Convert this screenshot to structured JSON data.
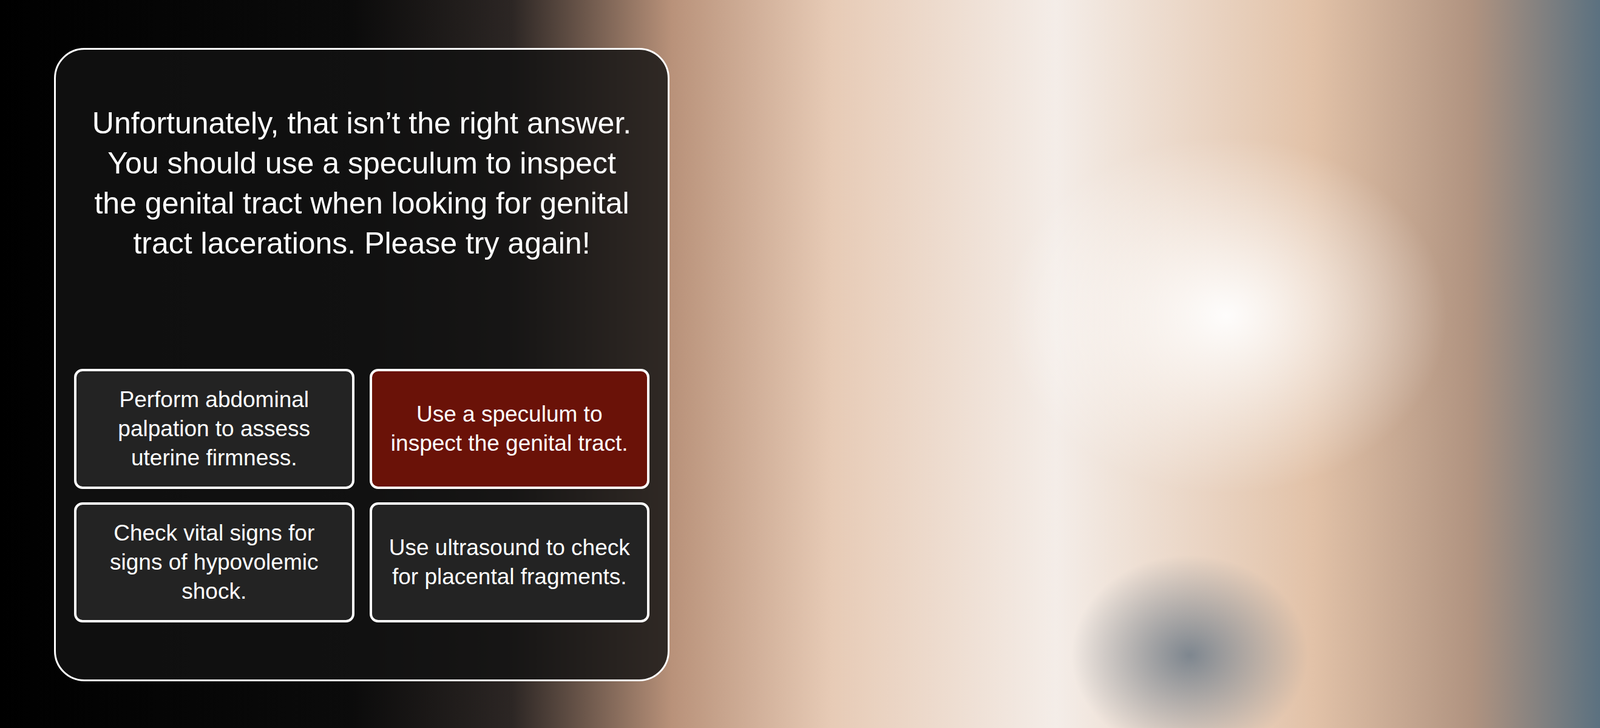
{
  "feedback": {
    "message": "Unfortunately, that isn’t the right answer. You should use a speculum to inspect the genital tract when looking for genital tract lacerations. Please try again!"
  },
  "answers": [
    {
      "label": "Perform abdominal palpation to assess uterine firmness.",
      "selected": false
    },
    {
      "label": "Use a speculum to inspect the genital tract.",
      "selected": true
    },
    {
      "label": "Check vital signs for signs of hypovolemic shock.",
      "selected": false
    },
    {
      "label": "Use ultrasound to check for placental fragments.",
      "selected": false
    }
  ]
}
